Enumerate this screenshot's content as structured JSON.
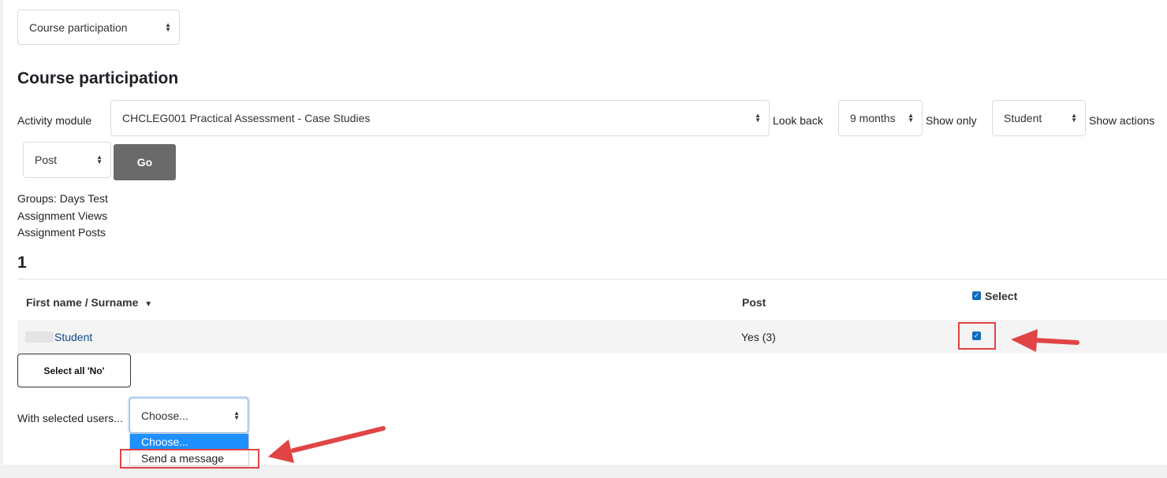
{
  "top_select": {
    "value": "Course participation"
  },
  "heading": "Course participation",
  "filters": {
    "activity_module_label": "Activity module",
    "activity_module_value": "CHCLEG001 Practical Assessment - Case Studies",
    "look_back_label": "Look back",
    "look_back_value": "9 months",
    "show_only_label": "Show only",
    "show_only_value": "Student",
    "show_actions_label": "Show actions",
    "show_actions_value": "Post",
    "go_label": "Go"
  },
  "info": {
    "groups": "Groups: Days Test",
    "views": "Assignment Views",
    "posts": "Assignment Posts"
  },
  "count": "1",
  "table": {
    "col_name": "First name / Surname",
    "col_post": "Post",
    "col_select": "Select",
    "rows": [
      {
        "name": "Student",
        "post": "Yes (3)",
        "selected": true
      }
    ]
  },
  "select_all_no_label": "Select all 'No'",
  "with_selected": {
    "label": "With selected users...",
    "value": "Choose...",
    "options": [
      "Choose...",
      "Send a message"
    ]
  },
  "colors": {
    "accent": "#0f6cbf",
    "highlight": "#1e90ff",
    "annotation": "#e04444",
    "go_button": "#6a6a6a"
  }
}
